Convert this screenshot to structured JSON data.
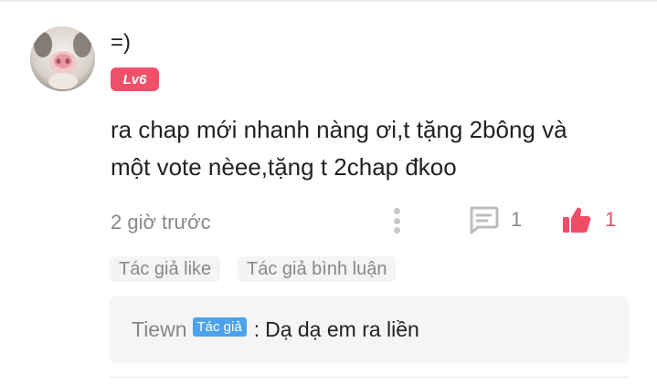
{
  "comment": {
    "username": "=)",
    "level": "Lv6",
    "text_line1": "ra chap mới nhanh nàng ơi,t tặng 2bông và",
    "text_line2": "một vote nèee,tặng t 2chap đkoo",
    "time": "2 giờ trước",
    "reply_count": "1",
    "like_count": "1",
    "tags": [
      "Tác giả like",
      "Tác giả bình luận"
    ]
  },
  "reply": {
    "author": "Tiewn",
    "author_badge": "Tác giả",
    "separator": ":",
    "text": "Dạ dạ em ra liền"
  },
  "colors": {
    "level_badge": "#f0516a",
    "like": "#ef4d66",
    "author_badge": "#4aa3ec",
    "muted_text": "#888888"
  },
  "icons": {
    "more": "more-vertical-icon",
    "reply": "comment-icon",
    "like": "thumbs-up-icon"
  }
}
